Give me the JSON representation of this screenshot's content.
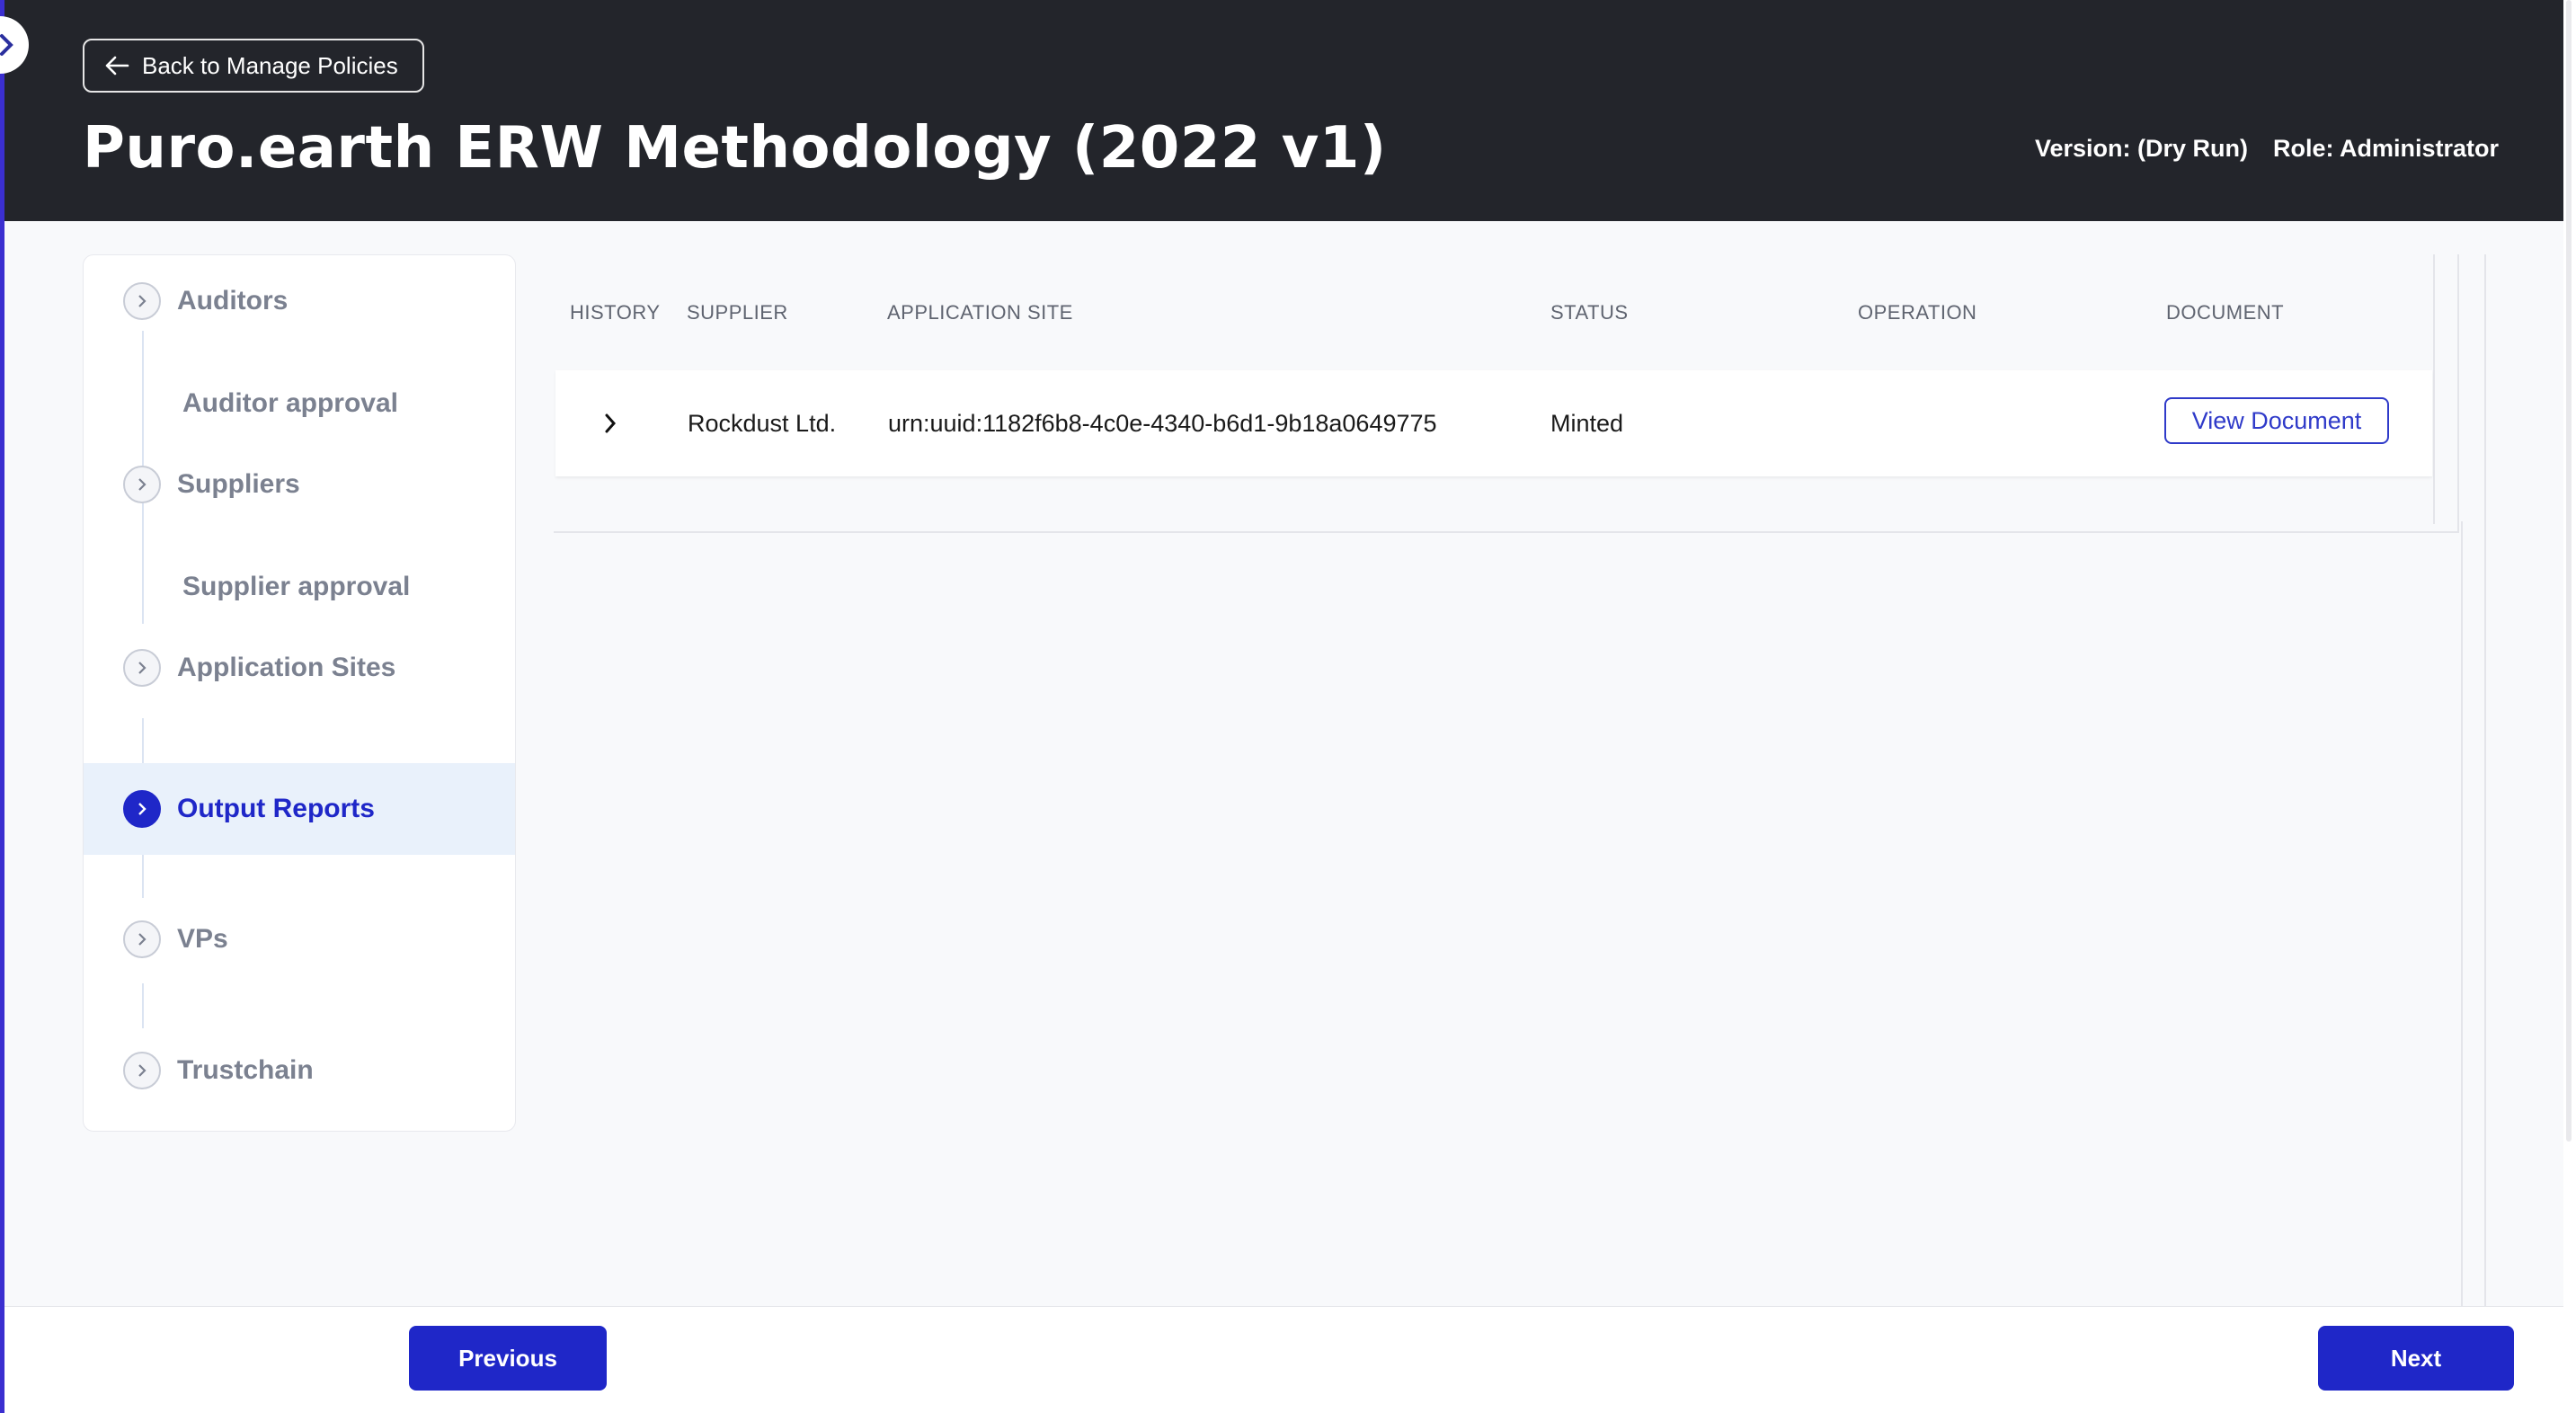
{
  "header": {
    "back_label": "Back to Manage Policies",
    "title": "Puro.earth ERW Methodology (2022 v1)",
    "version": "Version: (Dry Run)",
    "role": "Role: Administrator"
  },
  "sidebar": {
    "items": [
      {
        "label": "Auditors"
      },
      {
        "label": "Auditor approval"
      },
      {
        "label": "Suppliers"
      },
      {
        "label": "Supplier approval"
      },
      {
        "label": "Application Sites"
      },
      {
        "label": "Output Reports",
        "active": true
      },
      {
        "label": "VPs"
      },
      {
        "label": "Trustchain"
      }
    ]
  },
  "table": {
    "headers": [
      "HISTORY",
      "SUPPLIER",
      "APPLICATION SITE",
      "STATUS",
      "OPERATION",
      "DOCUMENT"
    ],
    "rows": [
      {
        "supplier": "Rockdust Ltd.",
        "application_site": "urn:uuid:1182f6b8-4c0e-4340-b6d1-9b18a0649775",
        "status": "Minted",
        "operation": "",
        "document_button": "View Document"
      }
    ]
  },
  "footer": {
    "previous_label": "Previous",
    "next_label": "Next"
  },
  "colors": {
    "header_bg": "#23252b",
    "accent": "#1f27c8",
    "active_bg": "#e9f1fb",
    "muted_text": "#7b8190"
  },
  "icons": {
    "back": "arrow-left-icon",
    "expand": "chevron-right-icon"
  }
}
